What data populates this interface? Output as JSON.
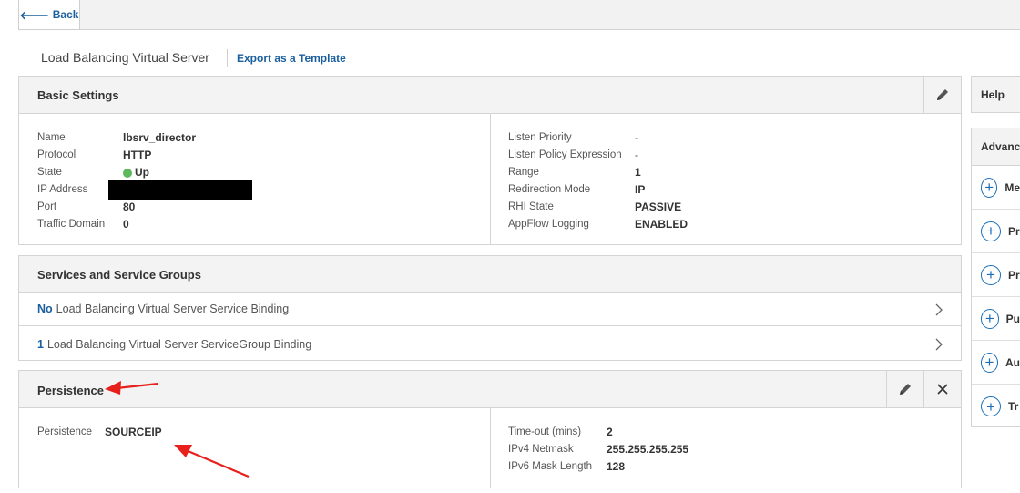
{
  "topbar": {
    "back_label": "Back"
  },
  "header": {
    "title": "Load Balancing Virtual Server",
    "export_label": "Export as a Template"
  },
  "basic_settings": {
    "title": "Basic Settings",
    "left": [
      {
        "label": "Name",
        "value": "lbsrv_director"
      },
      {
        "label": "Protocol",
        "value": "HTTP"
      },
      {
        "label": "State",
        "value": "Up"
      },
      {
        "label": "IP Address",
        "value": ""
      },
      {
        "label": "Port",
        "value": "80"
      },
      {
        "label": "Traffic Domain",
        "value": "0"
      }
    ],
    "right": [
      {
        "label": "Listen Priority",
        "value": "-"
      },
      {
        "label": "Listen Policy Expression",
        "value": "-"
      },
      {
        "label": "Range",
        "value": "1"
      },
      {
        "label": "Redirection Mode",
        "value": "IP"
      },
      {
        "label": "RHI State",
        "value": "PASSIVE"
      },
      {
        "label": "AppFlow Logging",
        "value": "ENABLED"
      }
    ]
  },
  "services": {
    "title": "Services and Service Groups",
    "rows": [
      {
        "count": "No",
        "label": "Load Balancing Virtual Server Service Binding"
      },
      {
        "count": "1",
        "label": "Load Balancing Virtual Server ServiceGroup Binding"
      }
    ]
  },
  "persistence": {
    "title": "Persistence",
    "left": [
      {
        "label": "Persistence",
        "value": "SOURCEIP"
      }
    ],
    "right": [
      {
        "label": "Time-out (mins)",
        "value": "2"
      },
      {
        "label": "IPv4 Netmask",
        "value": "255.255.255.255"
      },
      {
        "label": "IPv6 Mask Length",
        "value": "128"
      }
    ]
  },
  "sidebar": {
    "help_label": "Help",
    "advanced_label": "Advanc",
    "items": [
      "Me",
      "Pr",
      "Pr",
      "Pu",
      "Au",
      "Tr"
    ]
  },
  "colors": {
    "link": "#1a5f9e",
    "state_up": "#5cb85c",
    "annotation_arrow": "#e8201c",
    "redaction": "#000000"
  }
}
